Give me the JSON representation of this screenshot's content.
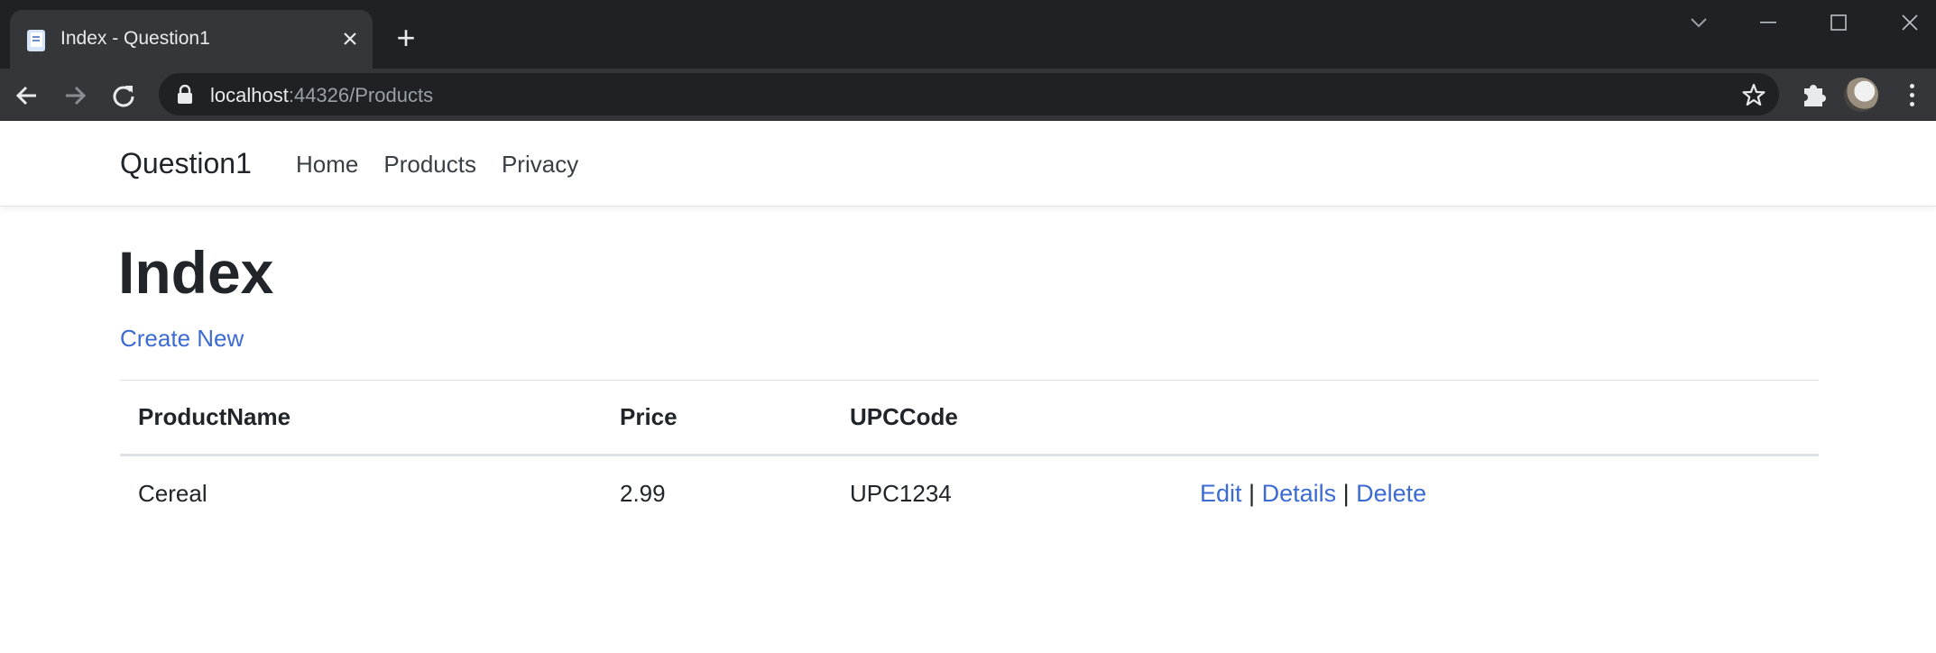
{
  "browser": {
    "tab_title": "Index - Question1",
    "new_tab_symbol": "+",
    "url_host": "localhost",
    "url_rest": ":44326/Products"
  },
  "site": {
    "brand": "Question1",
    "nav": [
      {
        "label": "Home"
      },
      {
        "label": "Products"
      },
      {
        "label": "Privacy"
      }
    ]
  },
  "main": {
    "heading": "Index",
    "create_new": "Create New",
    "table": {
      "headers": [
        "ProductName",
        "Price",
        "UPCCode"
      ],
      "rows": [
        {
          "product_name": "Cereal",
          "price": "2.99",
          "upc_code": "UPC1234",
          "actions": {
            "edit": "Edit",
            "details": "Details",
            "delete": "Delete",
            "separator": "|"
          }
        }
      ]
    }
  },
  "colors": {
    "chrome_dark": "#202124",
    "chrome_toolbar": "#35363a",
    "link_blue": "#3c6bd3",
    "text": "#212529"
  }
}
